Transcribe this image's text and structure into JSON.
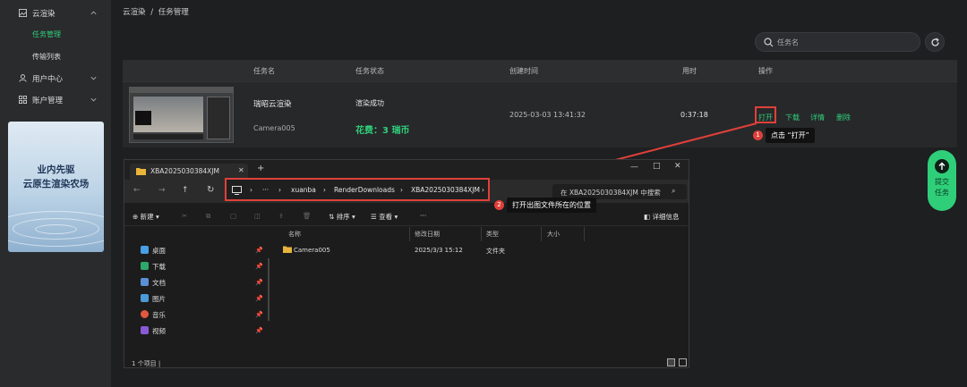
{
  "sidebar": {
    "group1": {
      "label": "云渲染"
    },
    "sub_items": [
      {
        "label": "任务管理",
        "active": true
      },
      {
        "label": "传输列表",
        "active": false
      }
    ],
    "group2": {
      "label": "用户中心"
    },
    "group3": {
      "label": "账户管理"
    },
    "banner": {
      "line1": "业内先驱",
      "line2": "云原生渲染农场"
    }
  },
  "breadcrumb": {
    "root": "云渲染",
    "sep": "/",
    "current": "任务管理"
  },
  "search": {
    "placeholder": "任务名"
  },
  "table": {
    "headers": {
      "name": "任务名",
      "status": "任务状态",
      "created": "创建时间",
      "duration": "用时",
      "actions": "操作"
    },
    "row": {
      "task_name": "瑞昭云渲染",
      "camera": "Camera005",
      "status": "渲染成功",
      "cost": "花费：3 瑞币",
      "created": "2025-03-03 13:41:32",
      "duration": "0:37:18",
      "actions": {
        "open": "打开",
        "download": "下载",
        "detail": "详情",
        "delete": "删除"
      }
    }
  },
  "annotations": {
    "step1_num": "1",
    "step1_text": "点击 “打开”",
    "step2_num": "2",
    "step2_text": "打开出图文件所在的位置"
  },
  "submit_button": {
    "line1": "提交",
    "line2": "任务"
  },
  "explorer": {
    "tab_title": "XBA2025030384XJM",
    "path": [
      "xuanba",
      "RenderDownloads",
      "XBA2025030384XJM"
    ],
    "ellipsis": "···",
    "search_placeholder": "在 XBA2025030384XJM 中搜索",
    "toolbar": {
      "new": "新建",
      "sort": "排序",
      "view": "查看",
      "more": "···",
      "details": "详细信息"
    },
    "nav": [
      {
        "label": "桌面",
        "color": "#4aa0e8"
      },
      {
        "label": "下载",
        "color": "#2ea86a"
      },
      {
        "label": "文档",
        "color": "#5b8fd6"
      },
      {
        "label": "图片",
        "color": "#4a9bd8"
      },
      {
        "label": "音乐",
        "color": "#e2583e"
      },
      {
        "label": "视频",
        "color": "#8a5ad6"
      }
    ],
    "columns": {
      "name": "名称",
      "modified": "修改日期",
      "type": "类型",
      "size": "大小"
    },
    "files": [
      {
        "name": "Camera005",
        "modified": "2025/3/3 15:12",
        "type": "文件夹",
        "size": ""
      }
    ],
    "status": "1 个项目  |"
  },
  "colors": {
    "accent": "#2fcf7a",
    "highlight": "#e0403a"
  }
}
